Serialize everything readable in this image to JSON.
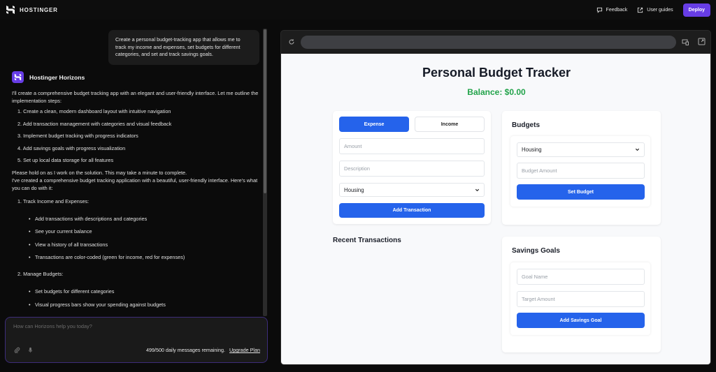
{
  "topbar": {
    "brand": "HOSTINGER",
    "feedback_label": "Feedback",
    "user_guides_label": "User guides",
    "deploy_label": "Deploy"
  },
  "chat": {
    "user_message": "Create a personal budget-tracking app that allows me to track my income and expenses, set budgets for different categories, and set and track savings goals.",
    "assistant_name": "Hostinger Horizons",
    "intro": "I'll create a comprehensive budget tracking app with an elegant and user-friendly interface. Let me outline the implementation steps:",
    "steps": [
      "1. Create a clean, modern dashboard layout with intuitive navigation",
      "2. Add transaction management with categories and visual feedback",
      "3. Implement budget tracking with progress indicators",
      "4. Add savings goals with progress visualization",
      "5. Set up local data storage for all features"
    ],
    "hold_on": "Please hold on as I work on the solution. This may take a minute to complete.",
    "created": "I've created a comprehensive budget tracking application with a beautiful, user-friendly interface. Here's what you can do with it:",
    "features": [
      {
        "heading": "1. Track Income and Expenses:",
        "bullets": [
          "Add transactions with descriptions and categories",
          "See your current balance",
          "View a history of all transactions",
          "Transactions are color-coded (green for income, red for expenses)"
        ]
      },
      {
        "heading": "2. Manage Budgets:",
        "bullets": [
          "Set budgets for different categories",
          "Visual progress bars show your spending against budgets"
        ]
      }
    ],
    "composer_placeholder": "How can Horizons help you today?",
    "messages_remaining": "499/500 daily messages remaining.",
    "upgrade_label": "Upgrade Plan"
  },
  "preview": {
    "url": "",
    "app": {
      "title": "Personal Budget Tracker",
      "balance": "Balance: $0.00",
      "transaction_form": {
        "expense_label": "Expense",
        "income_label": "Income",
        "active_type": "Expense",
        "amount_placeholder": "Amount",
        "description_placeholder": "Description",
        "category_selected": "Housing",
        "submit_label": "Add Transaction"
      },
      "recent_transactions_title": "Recent Transactions",
      "budgets": {
        "title": "Budgets",
        "category_selected": "Housing",
        "amount_placeholder": "Budget Amount",
        "submit_label": "Set Budget"
      },
      "savings_goals": {
        "title": "Savings Goals",
        "name_placeholder": "Goal Name",
        "target_placeholder": "Target Amount",
        "submit_label": "Add Savings Goal"
      }
    }
  },
  "colors": {
    "brand_purple": "#673de6",
    "primary_blue": "#2563eb",
    "balance_green": "#22a34a"
  }
}
